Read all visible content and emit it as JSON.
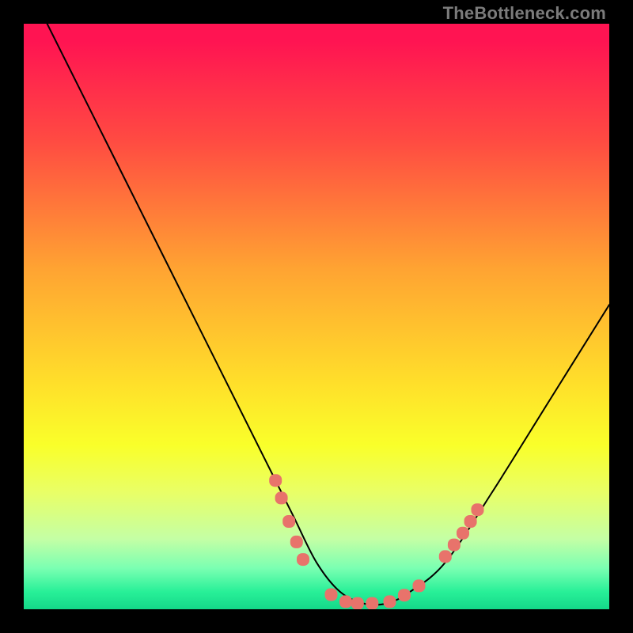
{
  "watermark": "TheBottleneck.com",
  "chart_data": {
    "type": "line",
    "title": "",
    "xlabel": "",
    "ylabel": "",
    "xlim": [
      0,
      100
    ],
    "ylim": [
      0,
      100
    ],
    "series": [
      {
        "name": "curve",
        "x": [
          4,
          14,
          24,
          35,
          42,
          46,
          50,
          54,
          58,
          62,
          66,
          72,
          80,
          90,
          100
        ],
        "y": [
          100,
          80,
          60,
          38,
          24,
          16,
          8,
          3,
          1,
          1,
          3,
          8,
          20,
          36,
          52
        ]
      }
    ],
    "markers": {
      "name": "salmon-dots",
      "color": "#e8736b",
      "points": [
        {
          "x": 43.0,
          "y": 22.0
        },
        {
          "x": 44.0,
          "y": 19.0
        },
        {
          "x": 45.3,
          "y": 15.0
        },
        {
          "x": 46.6,
          "y": 11.5
        },
        {
          "x": 47.7,
          "y": 8.5
        },
        {
          "x": 52.5,
          "y": 2.5
        },
        {
          "x": 55.0,
          "y": 1.3
        },
        {
          "x": 57.0,
          "y": 1.0
        },
        {
          "x": 59.5,
          "y": 1.0
        },
        {
          "x": 62.5,
          "y": 1.3
        },
        {
          "x": 65.0,
          "y": 2.4
        },
        {
          "x": 67.5,
          "y": 4.0
        },
        {
          "x": 72.0,
          "y": 9.0
        },
        {
          "x": 73.5,
          "y": 11.0
        },
        {
          "x": 75.0,
          "y": 13.0
        },
        {
          "x": 76.3,
          "y": 15.0
        },
        {
          "x": 77.5,
          "y": 17.0
        }
      ]
    }
  }
}
